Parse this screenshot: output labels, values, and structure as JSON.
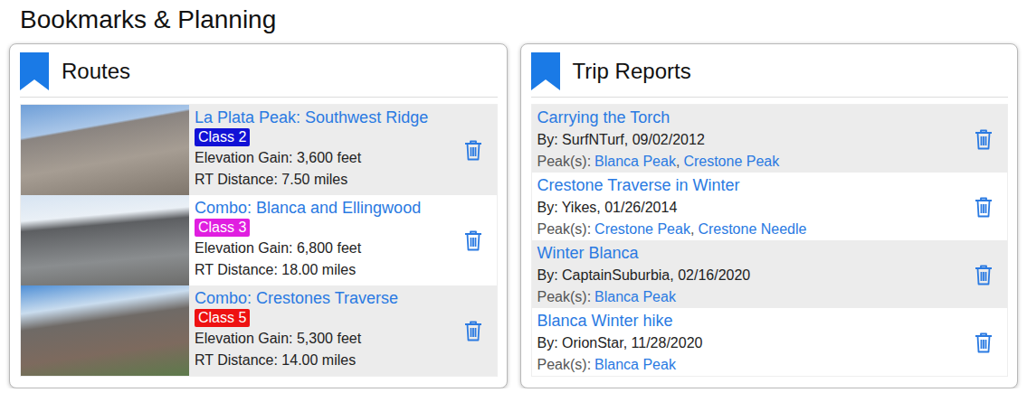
{
  "page": {
    "title": "Bookmarks & Planning"
  },
  "routes": {
    "title": "Routes",
    "items": [
      {
        "name": "La Plata Peak: Southwest Ridge",
        "class": "Class 2",
        "color": "#1111d6",
        "elevation": "Elevation Gain: 3,600 feet",
        "distance": "RT Distance: 7.50 miles"
      },
      {
        "name": "Combo: Blanca and Ellingwood",
        "class": "Class 3",
        "color": "#e01ee0",
        "elevation": "Elevation Gain: 6,800 feet",
        "distance": "RT Distance: 18.00 miles"
      },
      {
        "name": "Combo: Crestones Traverse",
        "class": "Class 5",
        "color": "#ee1111",
        "elevation": "Elevation Gain: 5,300 feet",
        "distance": "RT Distance: 14.00 miles"
      }
    ]
  },
  "trip_reports": {
    "title": "Trip Reports",
    "peaks_label": "Peak(s):",
    "peak_separator": ",",
    "items": [
      {
        "title": "Carrying the Torch",
        "byline": "By: SurfNTurf, 09/02/2012",
        "peaks": [
          "Blanca Peak",
          "Crestone Peak"
        ]
      },
      {
        "title": "Crestone Traverse in Winter",
        "byline": "By: Yikes, 01/26/2014",
        "peaks": [
          "Crestone Peak",
          "Crestone Needle"
        ]
      },
      {
        "title": "Winter Blanca",
        "byline": "By: CaptainSuburbia, 02/16/2020",
        "peaks": [
          "Blanca Peak"
        ]
      },
      {
        "title": "Blanca Winter hike",
        "byline": "By: OrionStar, 11/28/2020",
        "peaks": [
          "Blanca Peak"
        ]
      }
    ]
  }
}
